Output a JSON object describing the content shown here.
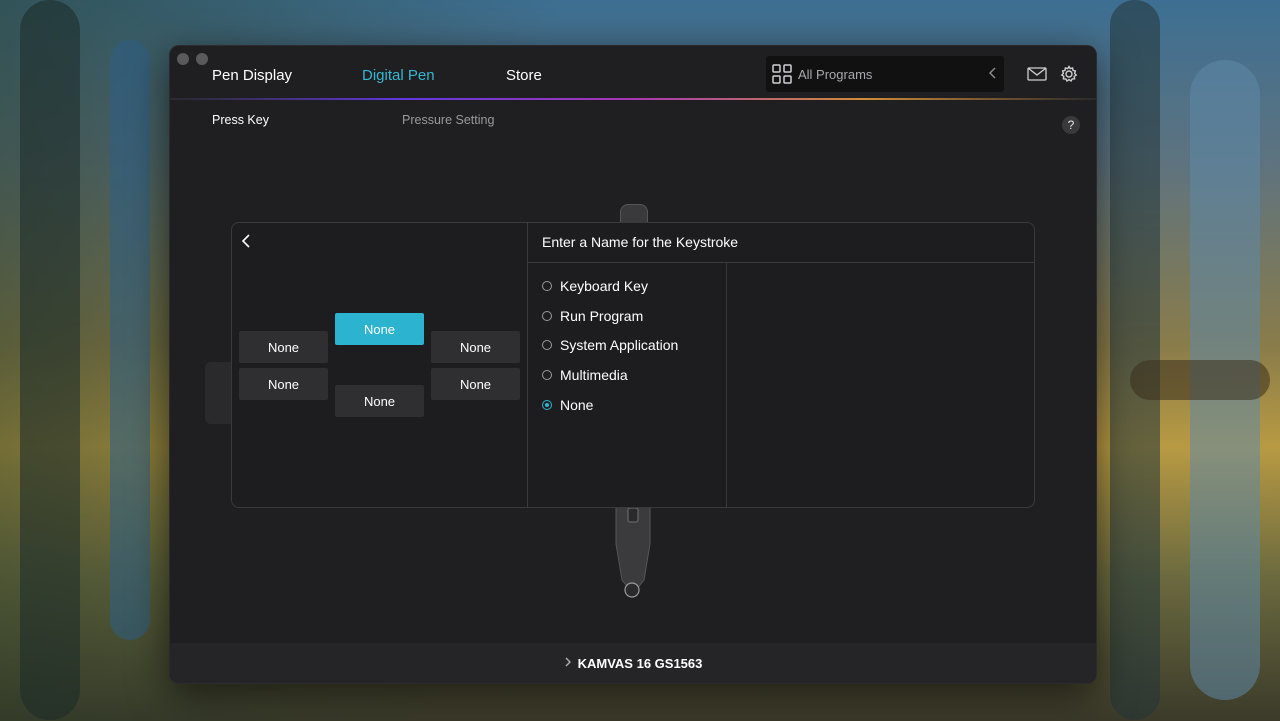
{
  "nav": {
    "tabs": [
      {
        "label": "Pen Display",
        "active": false
      },
      {
        "label": "Digital Pen",
        "active": true
      },
      {
        "label": "Store",
        "active": false
      }
    ],
    "program_select": {
      "label": "All Programs"
    },
    "accent_color": "#35b7d3"
  },
  "subtabs": {
    "press_key": "Press Key",
    "pressure_setting": "Pressure Setting",
    "help": "?"
  },
  "dialog": {
    "title": "Enter a Name for the Keystroke",
    "key_buttons": [
      {
        "label": "None",
        "selected": false
      },
      {
        "label": "None",
        "selected": false
      },
      {
        "label": "None",
        "selected": true
      },
      {
        "label": "None",
        "selected": false
      },
      {
        "label": "None",
        "selected": false
      },
      {
        "label": "None",
        "selected": false
      }
    ],
    "options": [
      {
        "label": "Keyboard Key",
        "checked": false
      },
      {
        "label": "Run Program",
        "checked": false
      },
      {
        "label": "System Application",
        "checked": false
      },
      {
        "label": "Multimedia",
        "checked": false
      },
      {
        "label": "None",
        "checked": true
      }
    ]
  },
  "footer": {
    "device": "KAMVAS 16 GS1563"
  }
}
